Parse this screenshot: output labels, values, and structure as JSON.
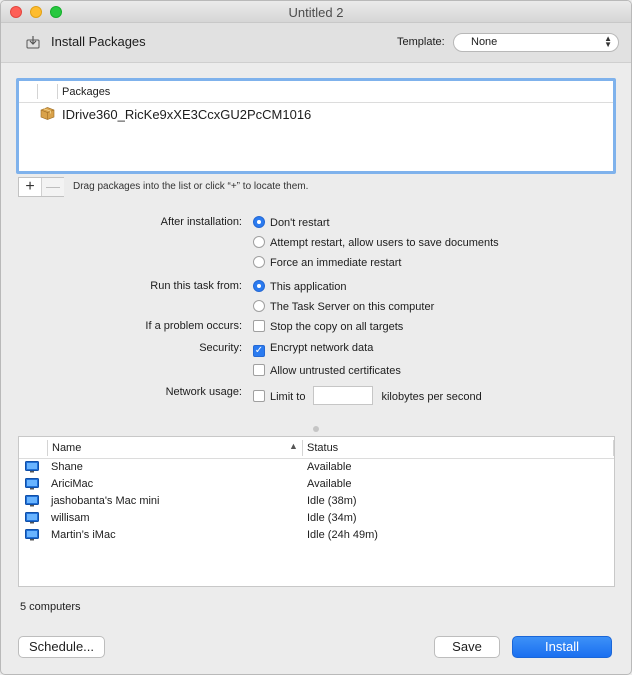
{
  "window": {
    "title": "Untitled 2"
  },
  "toolbar": {
    "title": "Install Packages",
    "template_label": "Template:",
    "template_value": "None"
  },
  "packages": {
    "header": "Packages",
    "items": [
      {
        "name": "IDrive360_RicKe9xXE3CcxGU2PcCM1016"
      }
    ],
    "add_symbol": "+",
    "remove_symbol": "—",
    "hint": "Drag packages into the list or click “+” to locate them."
  },
  "options": {
    "after_install": {
      "label": "After installation:",
      "choices": [
        "Don't restart",
        "Attempt restart, allow users to save documents",
        "Force an immediate restart"
      ],
      "selected": 0
    },
    "run_from": {
      "label": "Run this task from:",
      "choices": [
        "This application",
        "The Task Server on this computer"
      ],
      "selected": 0
    },
    "problem": {
      "label": "If a problem occurs:",
      "text": "Stop the copy on all targets",
      "checked": false
    },
    "security": {
      "label": "Security:",
      "encrypt": {
        "text": "Encrypt network data",
        "checked": true
      },
      "untrusted": {
        "text": "Allow untrusted certificates",
        "checked": false
      }
    },
    "network": {
      "label": "Network usage:",
      "limit_text": "Limit to",
      "unit_text": "kilobytes per second",
      "checked": false,
      "value": ""
    }
  },
  "computers": {
    "columns": {
      "name": "Name",
      "status": "Status"
    },
    "rows": [
      {
        "name": "Shane",
        "status": "Available"
      },
      {
        "name": "AriciMac",
        "status": "Available"
      },
      {
        "name": "jashobanta's Mac mini",
        "status": "Idle (38m)"
      },
      {
        "name": "willisam",
        "status": "Idle (34m)"
      },
      {
        "name": "Martin’s iMac",
        "status": "Idle (24h 49m)"
      }
    ],
    "count_text": "5 computers"
  },
  "buttons": {
    "schedule": "Schedule...",
    "save": "Save",
    "install": "Install"
  },
  "colors": {
    "accent": "#2b7bf0",
    "focus_ring": "#7fb2ec"
  },
  "icons": {
    "toolbar": "install-package-icon",
    "package": "package-box-icon",
    "computer": "monitor-icon"
  }
}
